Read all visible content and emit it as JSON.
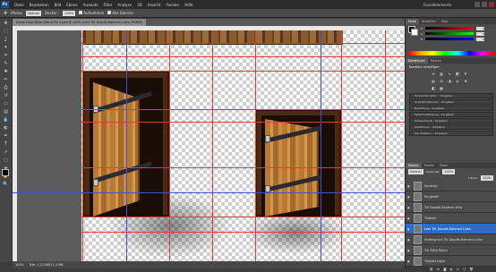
{
  "app": {
    "logo": "Ps",
    "workspace": "Grundelemente"
  },
  "menu": [
    "Datei",
    "Bearbeiten",
    "Bild",
    "Ebene",
    "Auswahl",
    "Filter",
    "Analyse",
    "3D",
    "Ansicht",
    "Fenster",
    "Hilfe"
  ],
  "options": {
    "style_label": "Modus",
    "style_value": "Normal",
    "width_label": "Deckkr.:",
    "width_value": "100%",
    "check1": "Aufnehmen",
    "check2": "Alle Ebenen"
  },
  "tab": {
    "title": "Game Door Wide (Wand Tür 2.psd @ 100% (Leer Tür Doodle-Rahmen Links, RGB/8)"
  },
  "tools": [
    "move-icon",
    "marquee-icon",
    "lasso-icon",
    "magic-wand-icon",
    "crop-icon",
    "eyedropper-icon",
    "heal-icon",
    "brush-icon",
    "stamp-icon",
    "history-brush-icon",
    "eraser-icon",
    "gradient-icon",
    "blur-icon",
    "dodge-icon",
    "pen-icon",
    "type-icon",
    "path-select-icon",
    "shape-icon",
    "3d-icon",
    "hand-icon",
    "zoom-icon"
  ],
  "tool_glyphs": [
    "✥",
    "⬚",
    "ʆ",
    "✦",
    "⌗",
    "✎",
    "✚",
    "✏",
    "⎙",
    "↺",
    "▭",
    "▤",
    "💧",
    "◐",
    "✒",
    "T",
    "➚",
    "▢",
    "◈",
    "✋",
    "🔍"
  ],
  "status": {
    "zoom": "100%",
    "doc": "Dok: 1,12 MB/11,0 MB"
  },
  "color_panel": {
    "tabs": [
      "Farbe",
      "Farbfelder",
      "Stile"
    ],
    "rows": [
      {
        "label": "R",
        "value": "0"
      },
      {
        "label": "G",
        "value": "0"
      },
      {
        "label": "B",
        "value": "0"
      }
    ]
  },
  "adjust_panel": {
    "tabs": [
      "Korrekturen",
      "Masken"
    ],
    "title": "Korrektur hinzufügen",
    "presets": [
      "Tonwertkorrektur - Vorgaben",
      "Gradationskurven - Vorgaben",
      "Belichtung - Vorgaben",
      "Farbton/Sättigung - Vorgaben",
      "Schwarzweiß - Vorgaben",
      "Kanalmixer - Vorgaben",
      "Sel. Farbkorr. - Vorgaben"
    ]
  },
  "layers_panel": {
    "tabs": [
      "Ebenen",
      "Kanäle",
      "Pfade"
    ],
    "blend": "Normal",
    "opacity_label": "Deckkraft:",
    "opacity": "100%",
    "fill_label": "Fläche:",
    "fill": "100%",
    "layers": [
      {
        "name": "Vordergr.",
        "selected": false
      },
      {
        "name": "Ringbrett",
        "selected": false
      },
      {
        "name": "Tür Doodle-Rahmen links",
        "selected": false
      },
      {
        "name": "Türblatt",
        "selected": false
      },
      {
        "name": "Leer Tür Doodle-Rahmen Links",
        "selected": true
      },
      {
        "name": "Hintergrund Tür Doodle-Rahmen Links",
        "selected": false
      },
      {
        "name": "Tür Seite Rahm",
        "selected": false
      },
      {
        "name": "Türblatt kopie",
        "selected": false
      }
    ]
  },
  "colors": {
    "selection": "#2f6cc7",
    "guide": "#e03a3a",
    "guide_blue": "#4050d8"
  }
}
